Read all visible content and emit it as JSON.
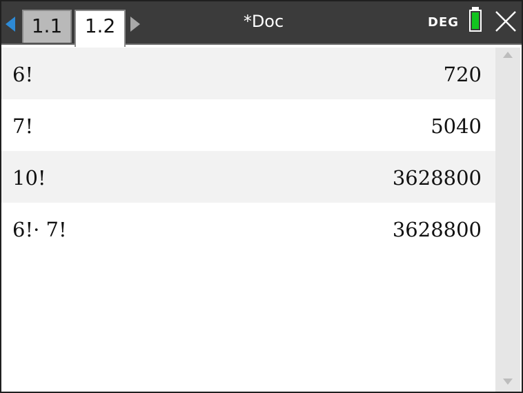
{
  "header": {
    "tabs": [
      {
        "label": "1.1"
      },
      {
        "label": "1.2"
      }
    ],
    "active_tab": "1.2",
    "document_title": "*Doc",
    "angle_mode": "DEG",
    "battery_color": "#12c41f",
    "icons": {
      "left": "left-arrow-icon",
      "right": "right-arrow-icon",
      "battery": "battery-icon",
      "close": "close-icon"
    }
  },
  "history": [
    {
      "expression": "6!",
      "result": "720"
    },
    {
      "expression": "7!",
      "result": "5040"
    },
    {
      "expression": "10!",
      "result": "3628800"
    },
    {
      "expression": "6!· 7!",
      "result": "3628800"
    }
  ],
  "scrollbar": {
    "up": "scroll-up-arrow-icon",
    "down": "scroll-down-arrow-icon"
  }
}
